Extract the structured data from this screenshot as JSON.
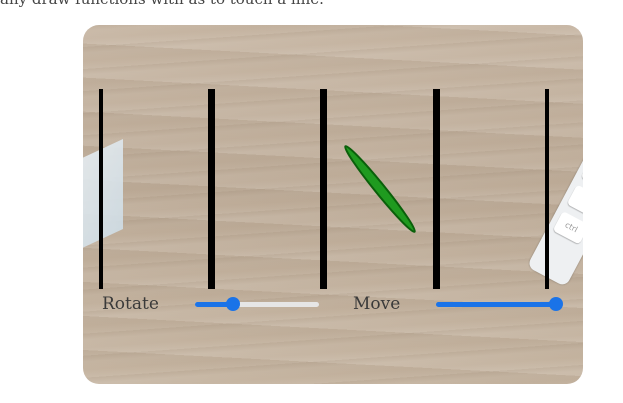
{
  "header": {
    "partial_text": "any draw functions with as to touch a line."
  },
  "scene": {
    "keyboard_key_label": "ctrl",
    "accent_color": "#1a73e8",
    "stick_color": "#0a7a0a"
  },
  "controls": {
    "rotate": {
      "label": "Rotate",
      "value_fraction": 0.32
    },
    "move": {
      "label": "Move",
      "value_fraction": 1.0
    }
  }
}
